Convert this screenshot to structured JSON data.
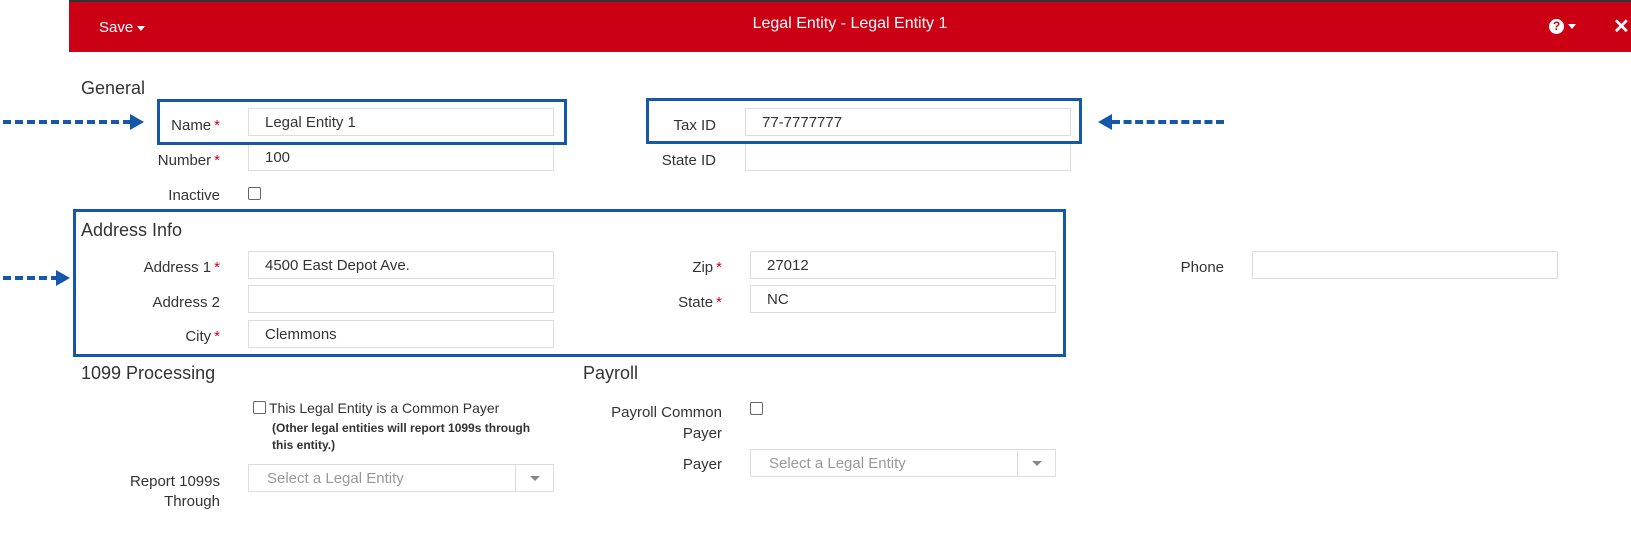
{
  "header": {
    "save_label": "Save",
    "title": "Legal Entity - Legal Entity 1",
    "help_icon": "question-circle-icon",
    "close_icon": "close-icon"
  },
  "general": {
    "section_title": "General",
    "name_label": "Name",
    "name_value": "Legal Entity 1",
    "number_label": "Number",
    "number_value": "100",
    "inactive_label": "Inactive",
    "inactive_checked": false,
    "tax_id_label": "Tax ID",
    "tax_id_value": "77-7777777",
    "state_id_label": "State ID",
    "state_id_value": "",
    "required_mark": "*"
  },
  "address": {
    "section_title": "Address Info",
    "address1_label": "Address 1",
    "address1_value": "4500 East Depot Ave.",
    "address2_label": "Address 2",
    "address2_value": "",
    "city_label": "City",
    "city_value": "Clemmons",
    "zip_label": "Zip",
    "zip_value": "27012",
    "state_label": "State",
    "state_value": "NC",
    "phone_label": "Phone",
    "phone_value": ""
  },
  "processing_1099": {
    "section_title": "1099 Processing",
    "common_payer_label": "This Legal Entity is a Common Payer",
    "common_payer_checked": false,
    "note_line1": "(Other legal entities will report 1099s through",
    "note_line2": "this entity.)",
    "report_label_line1": "Report 1099s",
    "report_label_line2": "Through",
    "report_placeholder": "Select a Legal Entity"
  },
  "payroll": {
    "section_title": "Payroll",
    "common_payer_label_line1": "Payroll Common",
    "common_payer_label_line2": "Payer",
    "common_payer_checked": false,
    "payer_label": "Payer",
    "payer_placeholder": "Select a Legal Entity"
  },
  "colors": {
    "header_bg": "#cc0014",
    "highlight": "#1557a8",
    "required": "#cc0014"
  }
}
